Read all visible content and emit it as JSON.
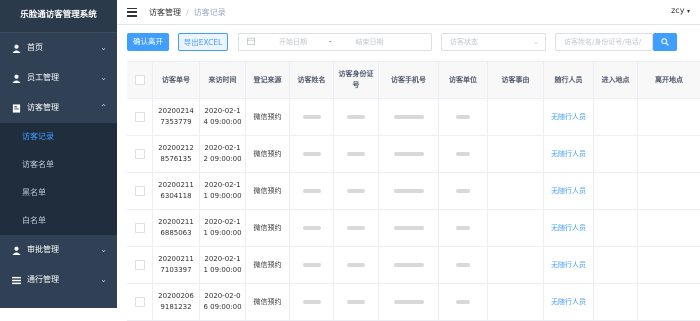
{
  "app": {
    "title": "乐脸通访客管理系统"
  },
  "user": {
    "name": "zcy"
  },
  "breadcrumb": {
    "parent": "访客管理",
    "current": "访客记录"
  },
  "sidebar": {
    "items": [
      {
        "label": "首页",
        "icon": "user-icon"
      },
      {
        "label": "员工管理",
        "icon": "user-icon"
      },
      {
        "label": "访客管理",
        "icon": "document-icon"
      },
      {
        "label": "审批管理",
        "icon": "user-icon"
      },
      {
        "label": "通行管理",
        "icon": "menu-icon"
      }
    ],
    "submenu": [
      "访客记录",
      "访客名单",
      "黑名单",
      "白名单"
    ]
  },
  "toolbar": {
    "confirm_label": "确认离开",
    "export_label": "导出EXCEL",
    "start_date_placeholder": "开始日期",
    "end_date_placeholder": "结束日期",
    "range_sep": "-",
    "status_placeholder": "访客状态",
    "search_placeholder": "访客姓名/身份证号/电话/",
    "search_icon": "search-icon"
  },
  "table": {
    "headers": [
      "访客单号",
      "来访时间",
      "登记来源",
      "访客姓名",
      "访客身份证号",
      "访客手机号",
      "访客单位",
      "访客事由",
      "随行人员",
      "进入地点",
      "离开地点"
    ],
    "rows": [
      {
        "order": "20200214 7353779",
        "time": "2020-02-1 4 09:00:00",
        "source": "微信预约",
        "companion": "无随行人员"
      },
      {
        "order": "20200212 8576135",
        "time": "2020-02-1 2 09:00:00",
        "source": "微信预约",
        "companion": "无随行人员"
      },
      {
        "order": "20200211 6304118",
        "time": "2020-02-1 1 09:00:00",
        "source": "微信预约",
        "companion": "无随行人员"
      },
      {
        "order": "20200211 6885063",
        "time": "2020-02-1 1 09:00:00",
        "source": "微信预约",
        "companion": "无随行人员"
      },
      {
        "order": "20200211 7103397",
        "time": "2020-02-1 1 09:00:00",
        "source": "微信预约",
        "companion": "无随行人员"
      },
      {
        "order": "20200206 9181232",
        "time": "2020-02-0 6 09:00:00",
        "source": "微信预约",
        "companion": "无随行人员"
      }
    ]
  },
  "colors": {
    "sidebar": "#304156",
    "accent": "#409eff"
  }
}
